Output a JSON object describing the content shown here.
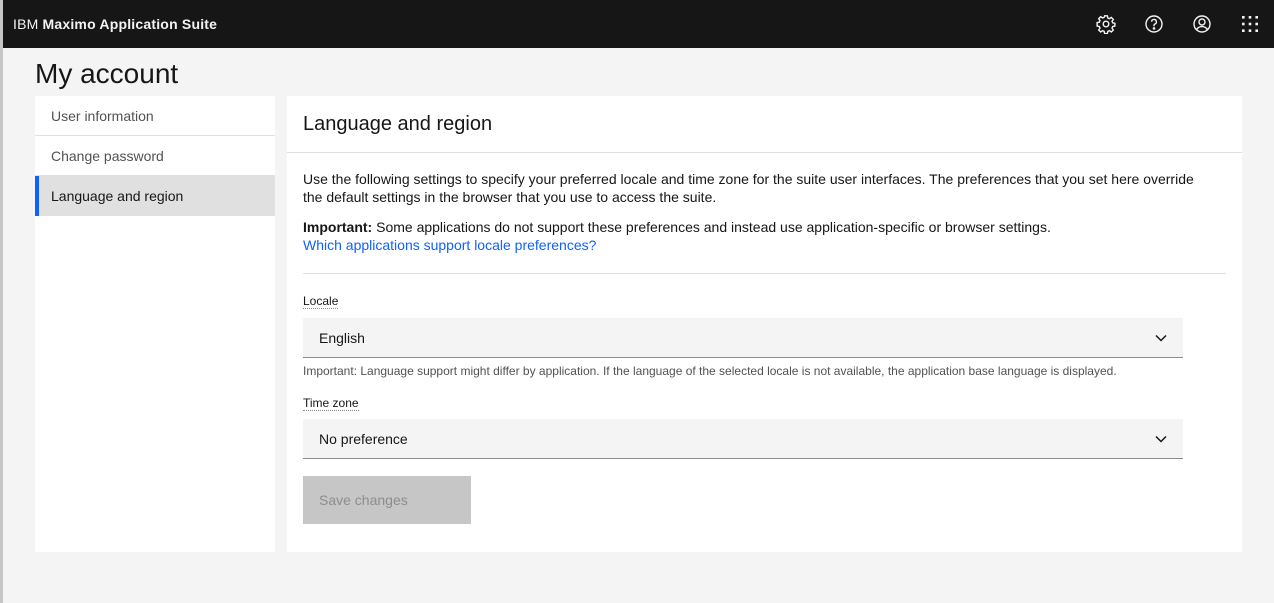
{
  "header": {
    "company": "IBM",
    "product": "Maximo Application Suite",
    "icons": [
      "gear-icon",
      "help-icon",
      "user-avatar-icon",
      "app-switcher-icon"
    ]
  },
  "page": {
    "title": "My account"
  },
  "sidebar": {
    "items": [
      {
        "label": "User information",
        "active": false
      },
      {
        "label": "Change password",
        "active": false
      },
      {
        "label": "Language and region",
        "active": true
      }
    ]
  },
  "panel": {
    "title": "Language and region",
    "description": "Use the following settings to specify your preferred locale and time zone for the suite user interfaces. The preferences that you set here override the default settings in the browser that you use to access the suite.",
    "important_label": "Important:",
    "important_text": " Some applications do not support these preferences and instead use application-specific or browser settings.",
    "link_text": "Which applications support locale preferences?",
    "locale": {
      "label": "Locale",
      "value": "English",
      "helper": "Important: Language support might differ by application. If the language of the selected locale is not available, the application base language is displayed."
    },
    "timezone": {
      "label": "Time zone",
      "value": "No preference"
    },
    "save_label": "Save changes"
  },
  "colors": {
    "topbar": "#161616",
    "accent": "#0f62fe",
    "background": "#f4f4f4"
  }
}
